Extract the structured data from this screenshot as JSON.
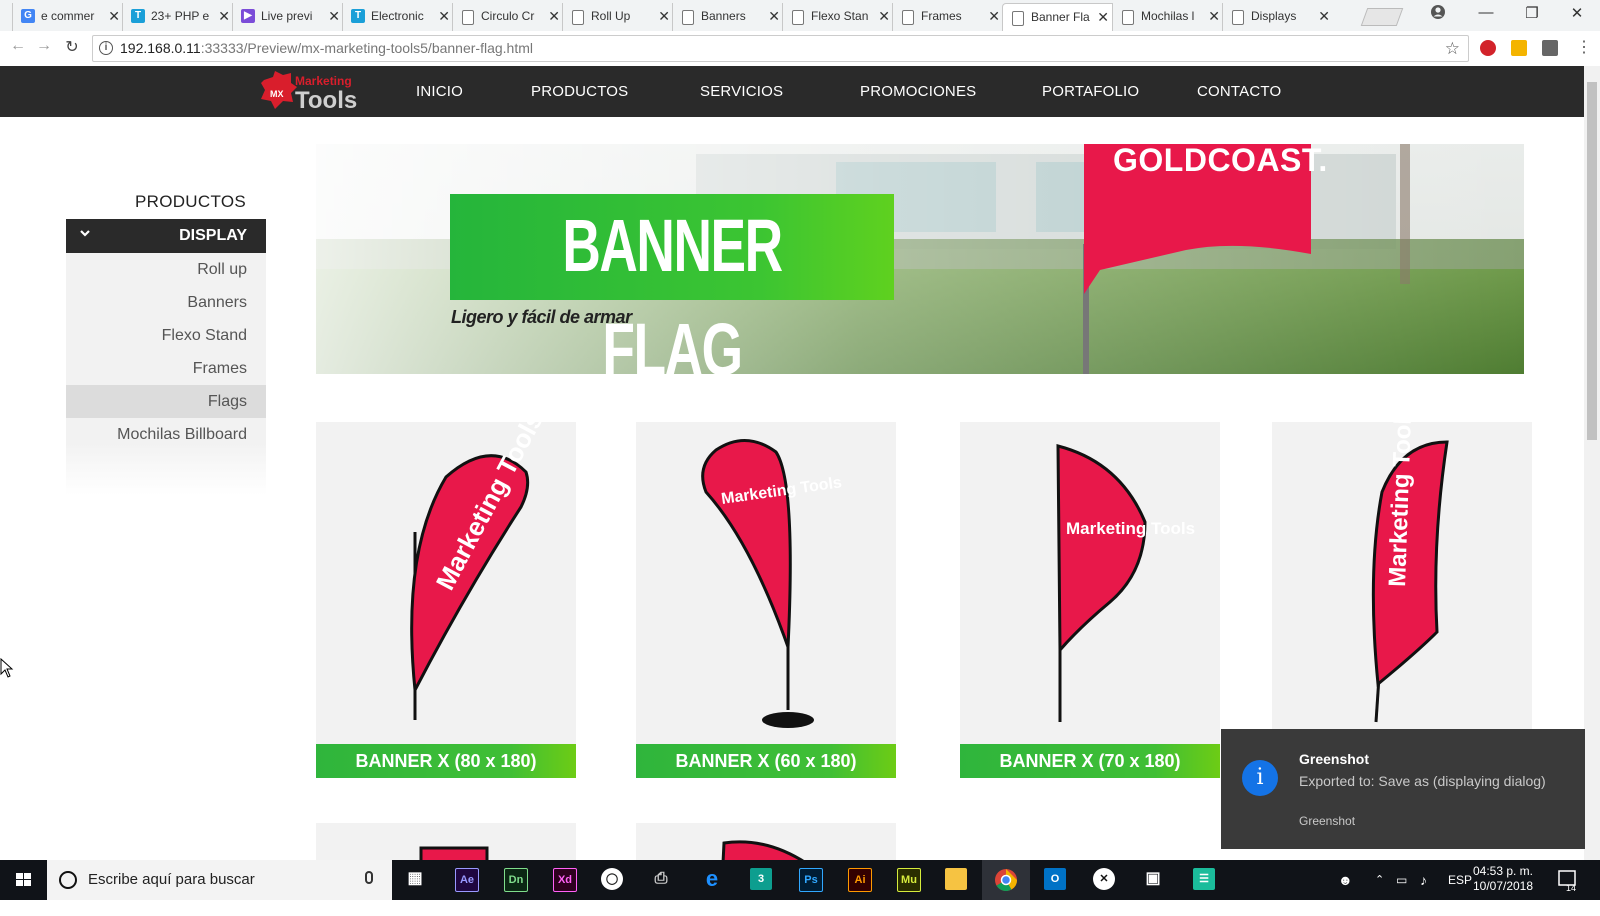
{
  "browser": {
    "tabs": [
      {
        "label": "e commer",
        "icon": "google-icon",
        "color": "#4285f4"
      },
      {
        "label": "23+ PHP e",
        "icon": "t-icon",
        "color": "#1a9fd8"
      },
      {
        "label": "Live previ",
        "icon": "live-preview-icon",
        "color": "#7b4cd8"
      },
      {
        "label": "Electronic",
        "icon": "t-icon",
        "color": "#1a9fd8"
      },
      {
        "label": "Circulo Cr",
        "icon": "page-icon"
      },
      {
        "label": "Roll Up",
        "icon": "page-icon"
      },
      {
        "label": "Banners",
        "icon": "page-icon"
      },
      {
        "label": "Flexo Stan",
        "icon": "page-icon"
      },
      {
        "label": "Frames",
        "icon": "page-icon"
      },
      {
        "label": "Banner Fla",
        "icon": "page-icon",
        "active": true
      },
      {
        "label": "Mochilas l",
        "icon": "page-icon"
      },
      {
        "label": "Displays",
        "icon": "page-icon"
      }
    ],
    "url_host": "192.168.0.11",
    "url_rest": ":33333/Preview/mx-marketing-tools5/banner-flag.html"
  },
  "site": {
    "logo_line1": "Marketing",
    "logo_line2": "Tools",
    "nav": [
      "INICIO",
      "PRODUCTOS",
      "SERVICIOS",
      "PROMOCIONES",
      "PORTAFOLIO",
      "CONTACTO"
    ],
    "sidebar": {
      "title": "PRODUCTOS",
      "category": "DISPLAY",
      "items": [
        "Roll up",
        "Banners",
        "Flexo Stand",
        "Frames",
        "Flags",
        "Mochilas Billboard"
      ],
      "active_item": "Flags"
    },
    "hero": {
      "title": "BANNER FLAG",
      "subtitle": "Ligero y fácil de armar",
      "flag_text": "GOLDCOAST."
    },
    "products": [
      {
        "label": "BANNER X (80 x 180)",
        "flag_text": "Marketing Tools"
      },
      {
        "label": "BANNER X (60 x 180)",
        "flag_text": "Marketing Tools"
      },
      {
        "label": "BANNER X (70 x 180)",
        "flag_text": "Marketing Tools"
      },
      {
        "label": "",
        "flag_text": "Marketing Tools"
      }
    ],
    "colors": {
      "accent_green": "#3cbf33",
      "flag_red": "#e8184a",
      "nav_dark": "#2a2a2a"
    }
  },
  "toast": {
    "app": "Greenshot",
    "message": "Exported to: Save as (displaying dialog)",
    "source": "Greenshot"
  },
  "taskbar": {
    "search_placeholder": "Escribe aquí para buscar",
    "language": "ESP",
    "time": "04:53 p. m.",
    "date": "10/07/2018",
    "notification_count": "14",
    "apps": [
      {
        "label": "Ae",
        "color": "#9999ff"
      },
      {
        "label": "Dn",
        "color": "#7fdd8b"
      },
      {
        "label": "Xd",
        "color": "#ff61f6"
      },
      {
        "label": "Ps",
        "color": "#31a8ff"
      },
      {
        "label": "Ai",
        "color": "#ff9a00"
      },
      {
        "label": "Mu",
        "color": "#d6ec3c"
      }
    ]
  }
}
